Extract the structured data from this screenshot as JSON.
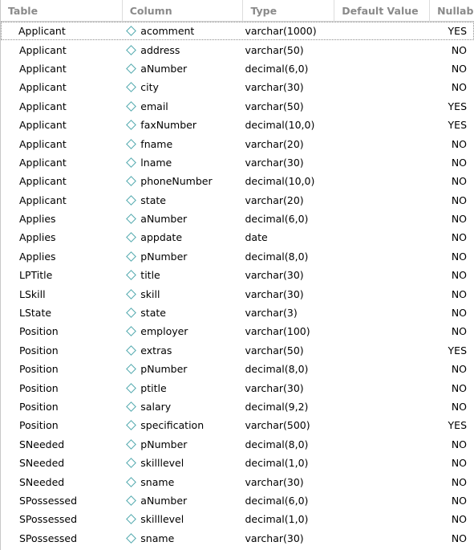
{
  "view": {
    "title": "Database Schema Columns Grid",
    "accent_icon_color": "#4fa8ad",
    "header_text_color": "#8a8a8a"
  },
  "table": {
    "columns": [
      {
        "key": "table",
        "label": "Table"
      },
      {
        "key": "column",
        "label": "Column"
      },
      {
        "key": "type",
        "label": "Type"
      },
      {
        "key": "default",
        "label": "Default Value"
      },
      {
        "key": "nullable",
        "label": "Nullab"
      }
    ],
    "column_icon": "diamond-icon",
    "focused_row_index": 0,
    "rows": [
      {
        "table": "Applicant",
        "column": "acomment",
        "type": "varchar(1000)",
        "default": "",
        "nullable": "YES"
      },
      {
        "table": "Applicant",
        "column": "address",
        "type": "varchar(50)",
        "default": "",
        "nullable": "NO"
      },
      {
        "table": "Applicant",
        "column": "aNumber",
        "type": "decimal(6,0)",
        "default": "",
        "nullable": "NO"
      },
      {
        "table": "Applicant",
        "column": "city",
        "type": "varchar(30)",
        "default": "",
        "nullable": "NO"
      },
      {
        "table": "Applicant",
        "column": "email",
        "type": "varchar(50)",
        "default": "",
        "nullable": "YES"
      },
      {
        "table": "Applicant",
        "column": "faxNumber",
        "type": "decimal(10,0)",
        "default": "",
        "nullable": "YES"
      },
      {
        "table": "Applicant",
        "column": "fname",
        "type": "varchar(20)",
        "default": "",
        "nullable": "NO"
      },
      {
        "table": "Applicant",
        "column": "lname",
        "type": "varchar(30)",
        "default": "",
        "nullable": "NO"
      },
      {
        "table": "Applicant",
        "column": "phoneNumber",
        "type": "decimal(10,0)",
        "default": "",
        "nullable": "NO"
      },
      {
        "table": "Applicant",
        "column": "state",
        "type": "varchar(20)",
        "default": "",
        "nullable": "NO"
      },
      {
        "table": "Applies",
        "column": "aNumber",
        "type": "decimal(6,0)",
        "default": "",
        "nullable": "NO"
      },
      {
        "table": "Applies",
        "column": "appdate",
        "type": "date",
        "default": "",
        "nullable": "NO"
      },
      {
        "table": "Applies",
        "column": "pNumber",
        "type": "decimal(8,0)",
        "default": "",
        "nullable": "NO"
      },
      {
        "table": "LPTitle",
        "column": "title",
        "type": "varchar(30)",
        "default": "",
        "nullable": "NO"
      },
      {
        "table": "LSkill",
        "column": "skill",
        "type": "varchar(30)",
        "default": "",
        "nullable": "NO"
      },
      {
        "table": "LState",
        "column": "state",
        "type": "varchar(3)",
        "default": "",
        "nullable": "NO"
      },
      {
        "table": "Position",
        "column": "employer",
        "type": "varchar(100)",
        "default": "",
        "nullable": "NO"
      },
      {
        "table": "Position",
        "column": "extras",
        "type": "varchar(50)",
        "default": "",
        "nullable": "YES"
      },
      {
        "table": "Position",
        "column": "pNumber",
        "type": "decimal(8,0)",
        "default": "",
        "nullable": "NO"
      },
      {
        "table": "Position",
        "column": "ptitle",
        "type": "varchar(30)",
        "default": "",
        "nullable": "NO"
      },
      {
        "table": "Position",
        "column": "salary",
        "type": "decimal(9,2)",
        "default": "",
        "nullable": "NO"
      },
      {
        "table": "Position",
        "column": "specification",
        "type": "varchar(500)",
        "default": "",
        "nullable": "YES"
      },
      {
        "table": "SNeeded",
        "column": "pNumber",
        "type": "decimal(8,0)",
        "default": "",
        "nullable": "NO"
      },
      {
        "table": "SNeeded",
        "column": "skilllevel",
        "type": "decimal(1,0)",
        "default": "",
        "nullable": "NO"
      },
      {
        "table": "SNeeded",
        "column": "sname",
        "type": "varchar(30)",
        "default": "",
        "nullable": "NO"
      },
      {
        "table": "SPossessed",
        "column": "aNumber",
        "type": "decimal(6,0)",
        "default": "",
        "nullable": "NO"
      },
      {
        "table": "SPossessed",
        "column": "skilllevel",
        "type": "decimal(1,0)",
        "default": "",
        "nullable": "NO"
      },
      {
        "table": "SPossessed",
        "column": "sname",
        "type": "varchar(30)",
        "default": "",
        "nullable": "NO"
      }
    ]
  }
}
